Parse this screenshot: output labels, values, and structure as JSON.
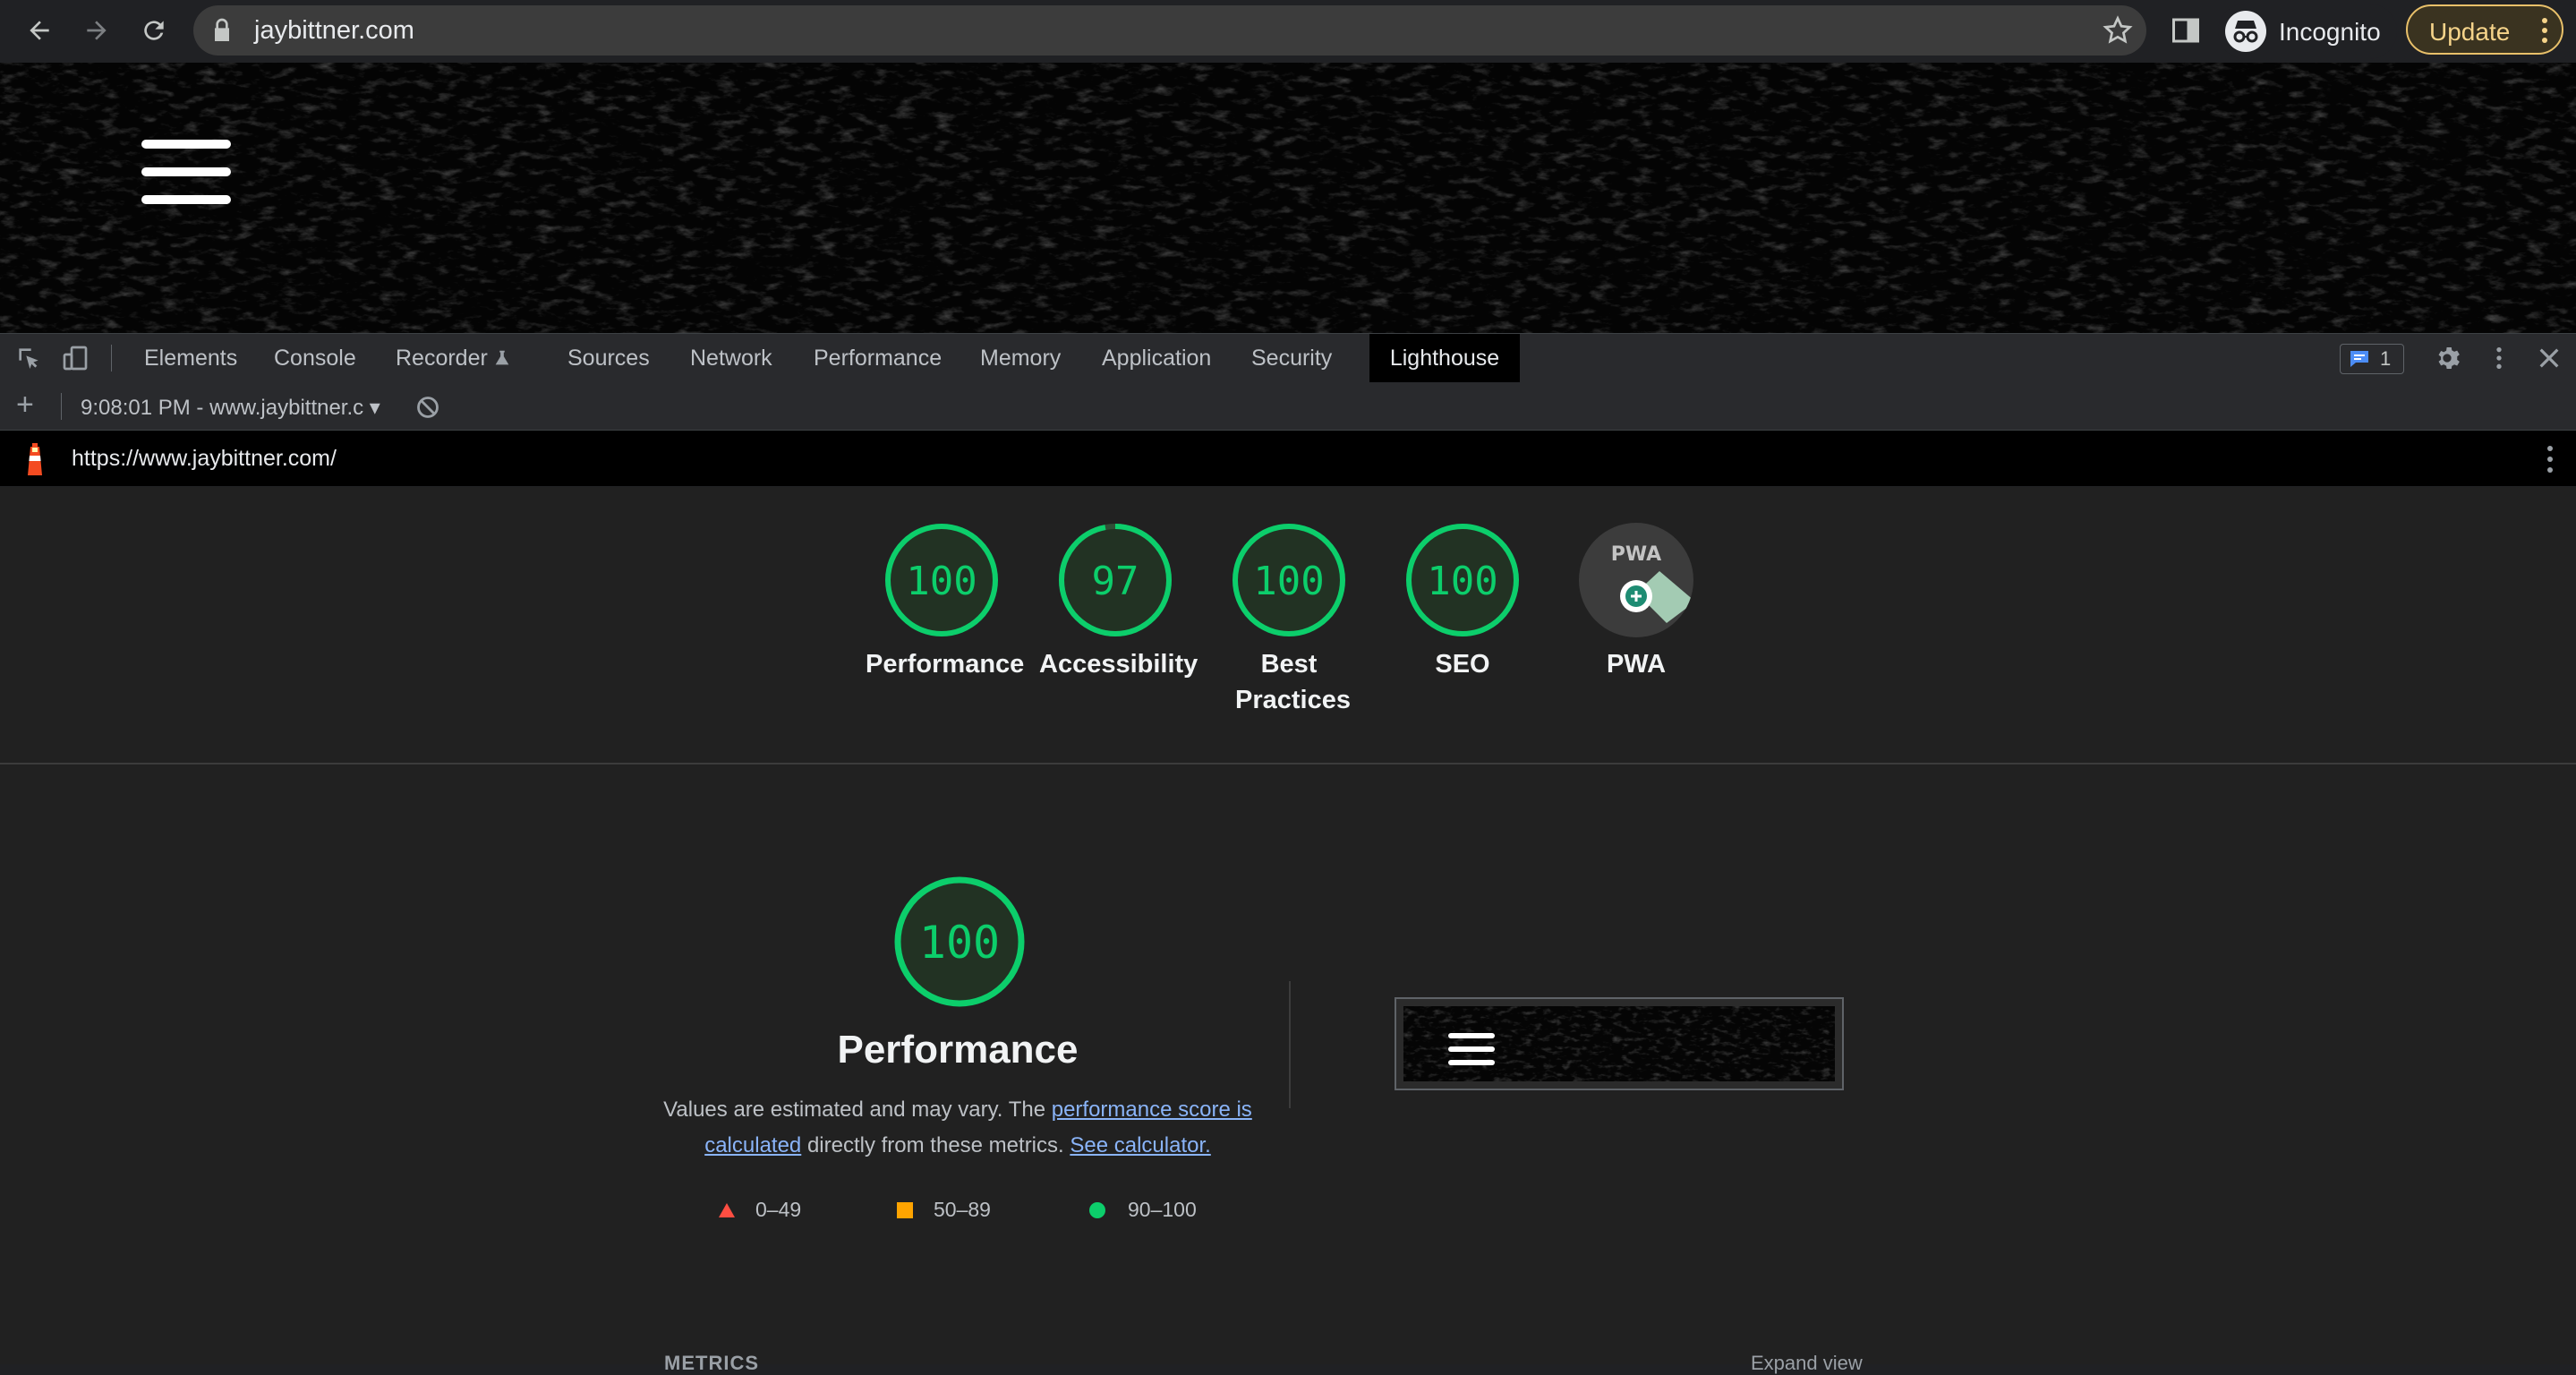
{
  "browser": {
    "url": "jaybittner.com",
    "profile_label": "Incognito",
    "update_label": "Update",
    "icons": [
      "back-icon",
      "forward-icon",
      "reload-icon",
      "lock-icon",
      "star-icon",
      "side-panel-icon",
      "incognito-icon",
      "more-icon"
    ]
  },
  "devtools": {
    "tabs": [
      "Elements",
      "Console",
      "Recorder",
      "Sources",
      "Network",
      "Performance",
      "Memory",
      "Application",
      "Security",
      "Lighthouse"
    ],
    "active_tab": "Lighthouse",
    "issues_count": "1",
    "report_selector": "9:08:01 PM - www.jaybittner.c",
    "report_url": "https://www.jaybittner.com/"
  },
  "categories": [
    {
      "label": "Performance",
      "score": "100"
    },
    {
      "label": "Accessibility",
      "score": "97"
    },
    {
      "label": "Best Practices",
      "score": "100"
    },
    {
      "label": "SEO",
      "score": "100"
    },
    {
      "label": "PWA",
      "score": "PWA"
    }
  ],
  "performance": {
    "score": "100",
    "title": "Performance",
    "desc_prefix": "Values are estimated and may vary. The ",
    "desc_link1": "performance score is calculated",
    "desc_middle": " directly from these metrics. ",
    "desc_link2": "See calculator.",
    "legend": [
      {
        "range": "0–49",
        "color": "#ff4e42"
      },
      {
        "range": "50–89",
        "color": "#ffa400"
      },
      {
        "range": "90–100",
        "color": "#0cce6b"
      }
    ],
    "metrics_label": "METRICS",
    "expand_label": "Expand view"
  },
  "colors": {
    "pass": "#0cce6b",
    "accent_update": "#f6d48a",
    "link": "#8ab4f8"
  }
}
